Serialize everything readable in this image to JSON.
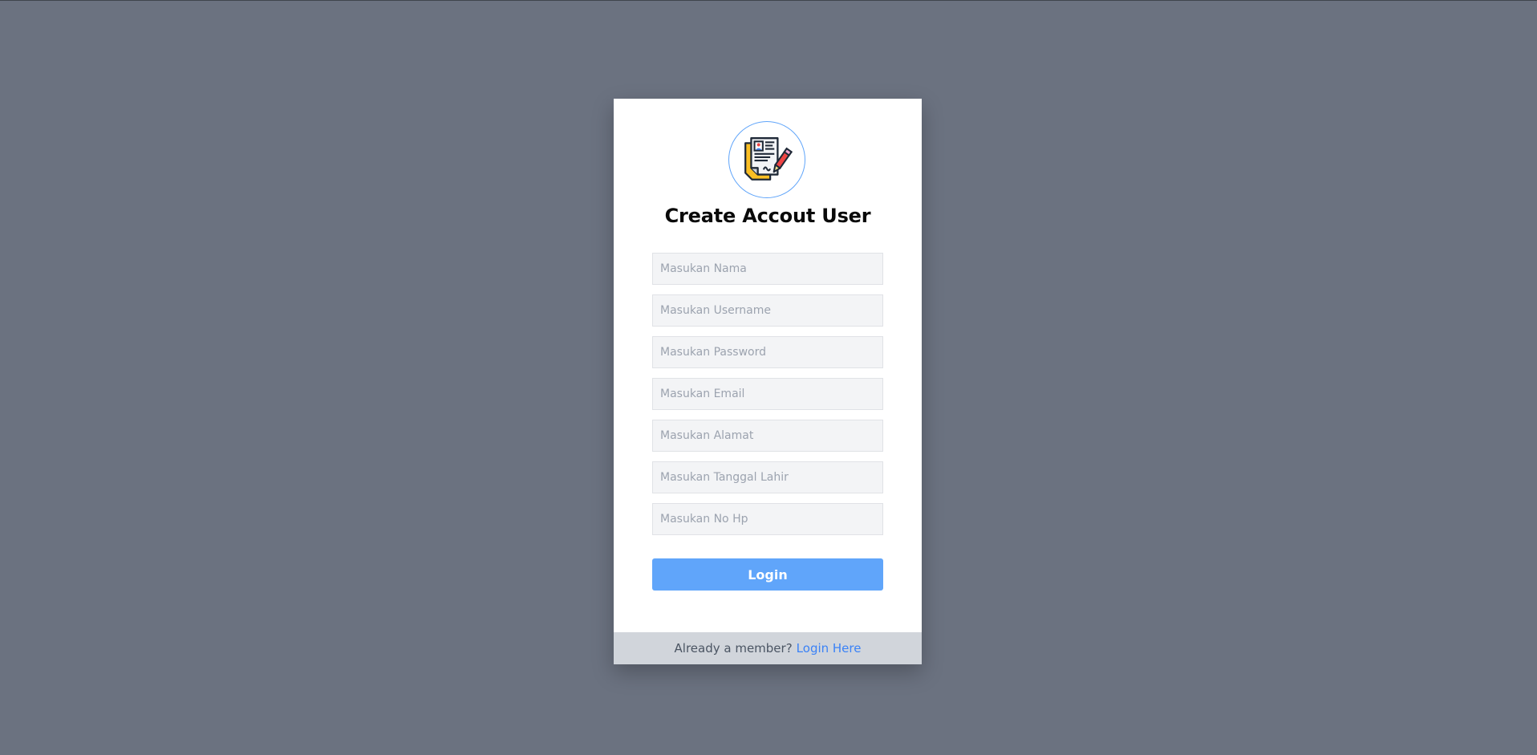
{
  "form": {
    "title": "Create Accout User",
    "logo_icon": "document-contract-icon",
    "fields": [
      {
        "name": "nama",
        "placeholder": "Masukan Nama",
        "value": ""
      },
      {
        "name": "username",
        "placeholder": "Masukan Username",
        "value": ""
      },
      {
        "name": "password",
        "placeholder": "Masukan Password",
        "value": ""
      },
      {
        "name": "email",
        "placeholder": "Masukan Email",
        "value": ""
      },
      {
        "name": "alamat",
        "placeholder": "Masukan Alamat",
        "value": ""
      },
      {
        "name": "tanggal_lahir",
        "placeholder": "Masukan Tanggal Lahir",
        "value": ""
      },
      {
        "name": "no_hp",
        "placeholder": "Masukan No Hp",
        "value": ""
      }
    ],
    "submit_label": "Login"
  },
  "footer": {
    "prompt": "Already a member?",
    "link_label": "Login Here"
  },
  "colors": {
    "background": "#6b7280",
    "accent": "#60a5fa",
    "link": "#3b82f6",
    "footer_bg": "#d1d5db"
  }
}
